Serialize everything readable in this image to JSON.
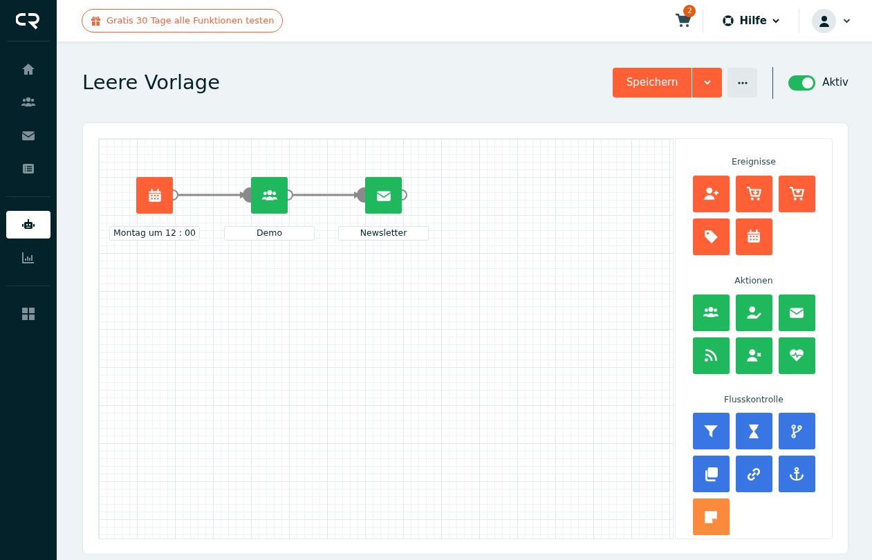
{
  "sidebar": {
    "groups": [
      {
        "items": [
          {
            "kind": "home",
            "selected": false
          },
          {
            "kind": "users",
            "selected": false
          },
          {
            "kind": "mail",
            "selected": false
          },
          {
            "kind": "list",
            "selected": false
          }
        ]
      },
      {
        "items": [
          {
            "kind": "robot",
            "selected": true
          },
          {
            "kind": "chart",
            "selected": false
          }
        ]
      },
      {
        "items": [
          {
            "kind": "grid",
            "selected": false
          }
        ]
      }
    ]
  },
  "topbar": {
    "trial_button": "Gratis 30 Tage alle Funktionen testen",
    "cart_count": "2",
    "help_menu": "Hilfe"
  },
  "page": {
    "title": "Leere Vorlage",
    "save_button": "Speichern",
    "active_toggle": {
      "label": "Aktiv",
      "on": true
    }
  },
  "canvas": {
    "nodes": [
      {
        "kind": "calendar",
        "color": "#ff6035",
        "label": "Montag um 12 : 00"
      },
      {
        "kind": "users",
        "color": "#20b85c",
        "label": "Demo"
      },
      {
        "kind": "mail",
        "color": "#20b85c",
        "label": "Newsletter"
      }
    ]
  },
  "palette": {
    "groups": [
      {
        "title": "Ereignisse",
        "tiles": [
          {
            "kind": "user-plus",
            "color": "#ff6035"
          },
          {
            "kind": "cart-down",
            "color": "#ff6035"
          },
          {
            "kind": "cart-plus",
            "color": "#ff6035"
          },
          {
            "kind": "tag",
            "color": "#ff6035"
          },
          {
            "kind": "calendar",
            "color": "#ff6035"
          }
        ]
      },
      {
        "title": "Aktionen",
        "tiles": [
          {
            "kind": "users",
            "color": "#20b85c"
          },
          {
            "kind": "user-edit",
            "color": "#20b85c"
          },
          {
            "kind": "mail",
            "color": "#20b85c"
          },
          {
            "kind": "rss",
            "color": "#20b85c"
          },
          {
            "kind": "user-x",
            "color": "#20b85c"
          },
          {
            "kind": "heart",
            "color": "#20b85c"
          }
        ]
      },
      {
        "title": "Flusskontrolle",
        "tiles": [
          {
            "kind": "filter",
            "color": "#3776e3"
          },
          {
            "kind": "hourglass",
            "color": "#3776e3"
          },
          {
            "kind": "branch",
            "color": "#3776e3"
          },
          {
            "kind": "copy",
            "color": "#3776e3"
          },
          {
            "kind": "link",
            "color": "#3776e3"
          },
          {
            "kind": "anchor",
            "color": "#3776e3"
          },
          {
            "kind": "note",
            "color": "#fb8a3c"
          }
        ]
      }
    ]
  }
}
